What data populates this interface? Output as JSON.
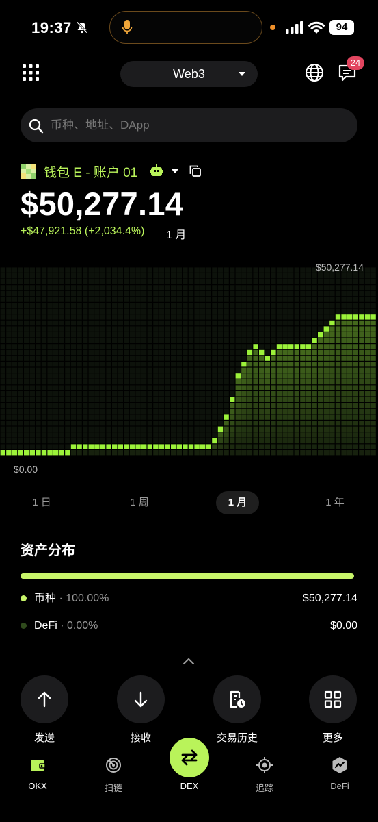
{
  "status_bar": {
    "time": "19:37",
    "battery": "94"
  },
  "header": {
    "network": "Web3",
    "notification_count": "24"
  },
  "search": {
    "placeholder": "币种、地址、DApp"
  },
  "wallet": {
    "name": "钱包 E - 账户 01",
    "balance": "$50,277.14",
    "pnl": "+$47,921.58 (+2,034.4%)",
    "pnl_period": "1 月"
  },
  "chart": {
    "max_label": "$50,277.14",
    "min_label": "$0.00"
  },
  "chart_data": {
    "type": "area",
    "ylim": [
      0,
      50277.14
    ],
    "values": [
      1500,
      1500,
      1500,
      1500,
      1500,
      1500,
      1500,
      1500,
      1500,
      1500,
      1500,
      1500,
      2400,
      2400,
      2000,
      2000,
      2000,
      2000,
      2400,
      2400,
      2400,
      2400,
      2400,
      2000,
      2400,
      2400,
      2800,
      2800,
      3500,
      3500,
      3500,
      3200,
      3200,
      3200,
      3200,
      3000,
      4400,
      7500,
      11500,
      17500,
      24500,
      28000,
      30500,
      32000,
      31500,
      30000,
      31500,
      32500,
      33000,
      32500,
      32500,
      32500,
      33000,
      35000,
      37000,
      38500,
      40500,
      41500,
      41500,
      42000,
      42000,
      42000,
      42000,
      42000
    ],
    "color": "#9cf23a"
  },
  "period_tabs": {
    "tab_1d": "1 日",
    "tab_1w": "1 周",
    "tab_1m": "1 月",
    "tab_1y": "1 年"
  },
  "assets": {
    "title": "资产分布",
    "rows": [
      {
        "label": "币种",
        "pct": "100.00%",
        "value": "$50,277.14",
        "color": "#c8f56a"
      },
      {
        "label": "DeFi",
        "pct": "0.00%",
        "value": "$0.00",
        "color": "#2f4a1c"
      }
    ]
  },
  "actions": {
    "send": "发送",
    "receive": "接收",
    "history": "交易历史",
    "more": "更多"
  },
  "nav": {
    "okx": "OKX",
    "scan": "扫链",
    "dex": "DEX",
    "track": "追踪",
    "defi": "DeFi"
  }
}
